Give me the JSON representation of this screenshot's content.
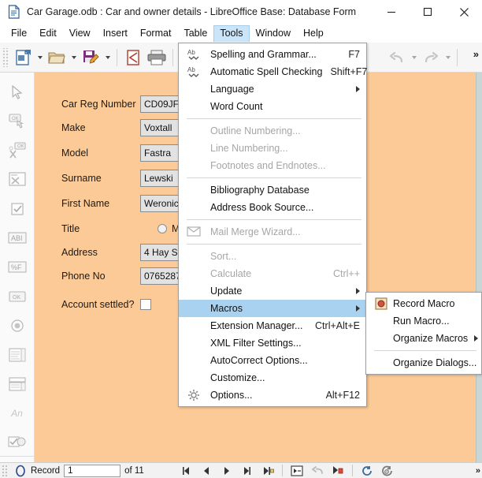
{
  "window": {
    "title": "Car Garage.odb : Car and owner details - LibreOffice Base: Database Form",
    "doc_icon": "document-icon",
    "minimize_label": "Minimize",
    "maximize_label": "Maximize",
    "close_label": "Close"
  },
  "menubar": {
    "items": [
      {
        "label": "File",
        "mnemonic": "F",
        "active": false
      },
      {
        "label": "Edit",
        "mnemonic": "E",
        "active": false
      },
      {
        "label": "View",
        "mnemonic": "V",
        "active": false
      },
      {
        "label": "Insert",
        "mnemonic": "I",
        "active": false
      },
      {
        "label": "Format",
        "mnemonic": "o",
        "active": false
      },
      {
        "label": "Table",
        "mnemonic": "T",
        "active": false
      },
      {
        "label": "Tools",
        "mnemonic": "T",
        "active": true
      },
      {
        "label": "Window",
        "mnemonic": "W",
        "active": false
      },
      {
        "label": "Help",
        "mnemonic": "H",
        "active": false
      }
    ]
  },
  "toolbar": {
    "items": [
      {
        "name": "new-document-button",
        "icon": "new-document-icon",
        "caret": true,
        "disabled": false
      },
      {
        "name": "open-button",
        "icon": "open-folder-icon",
        "caret": true,
        "disabled": false
      },
      {
        "name": "save-button",
        "icon": "save-edit-icon",
        "caret": true,
        "disabled": false
      },
      {
        "name": "export-pdf-button",
        "icon": "pdf-icon",
        "caret": false,
        "disabled": false
      },
      {
        "name": "print-button",
        "icon": "printer-icon",
        "caret": false,
        "disabled": false
      },
      {
        "name": "undo-button",
        "icon": "undo-icon",
        "caret": true,
        "disabled": true
      },
      {
        "name": "redo-button",
        "icon": "redo-icon",
        "caret": true,
        "disabled": true
      }
    ],
    "overflow_label": "»"
  },
  "sidebar": {
    "items": [
      {
        "name": "select-tool",
        "icon": "cursor-arrow-icon"
      },
      {
        "name": "push-button-control",
        "icon": "push-button-icon"
      },
      {
        "name": "form-design-tools",
        "icon": "form-design-icon"
      },
      {
        "name": "control-wizards",
        "icon": "control-wizard-icon"
      },
      {
        "name": "check-box-control",
        "icon": "check-box-icon"
      },
      {
        "name": "label-field-control",
        "icon": "label-field-icon"
      },
      {
        "name": "formatted-field-control",
        "icon": "formatted-field-icon"
      },
      {
        "name": "ok-button-control",
        "icon": "ok-button-icon"
      },
      {
        "name": "option-button-control",
        "icon": "option-button-icon"
      },
      {
        "name": "list-box-control",
        "icon": "list-box-icon"
      },
      {
        "name": "combo-box-control",
        "icon": "combo-box-icon"
      },
      {
        "name": "text-box-control",
        "icon": "text-box-an-icon",
        "text": "An"
      },
      {
        "name": "group-box-control",
        "icon": "group-box-icon"
      },
      {
        "name": "more-controls",
        "icon": "chevron-double-down-icon"
      }
    ]
  },
  "form": {
    "fields": [
      {
        "label": "Car Reg Number",
        "value": "CD09JFT",
        "type": "text"
      },
      {
        "label": "Make",
        "value": "Voxtall",
        "type": "text"
      },
      {
        "label": "Model",
        "value": "Fastra",
        "type": "text"
      },
      {
        "label": "Surname",
        "value": "Lewski",
        "type": "text"
      },
      {
        "label": "First Name",
        "value": "Weronica",
        "type": "text"
      },
      {
        "label": "Title",
        "value": "Mr",
        "type": "radio",
        "checked": false
      },
      {
        "label": "Address",
        "value": "4 Hay St",
        "type": "text"
      },
      {
        "label": "Phone No",
        "value": "076528765",
        "type": "text"
      },
      {
        "label": "Account settled?",
        "value": "",
        "type": "checkbox",
        "checked": false
      }
    ]
  },
  "tools_menu": {
    "items": [
      {
        "label": "Spelling and Grammar...",
        "shortcut": "F7",
        "icon": "abc-check-icon",
        "disabled": false,
        "submenu": false,
        "highlight": false,
        "mnemonic": "S"
      },
      {
        "label": "Automatic Spell Checking",
        "shortcut": "Shift+F7",
        "icon": "abc-auto-icon",
        "disabled": false,
        "submenu": false,
        "highlight": false,
        "mnemonic": "A"
      },
      {
        "label": "Language",
        "shortcut": "",
        "icon": "",
        "disabled": false,
        "submenu": true,
        "highlight": false,
        "mnemonic": "g"
      },
      {
        "label": "Word Count",
        "shortcut": "",
        "icon": "",
        "disabled": false,
        "submenu": false,
        "highlight": false,
        "mnemonic": "W"
      },
      {
        "separator": true
      },
      {
        "label": "Outline Numbering...",
        "shortcut": "",
        "icon": "",
        "disabled": true,
        "submenu": false,
        "highlight": false,
        "mnemonic": "N"
      },
      {
        "label": "Line Numbering...",
        "shortcut": "",
        "icon": "",
        "disabled": true,
        "submenu": false,
        "highlight": false,
        "mnemonic": ""
      },
      {
        "label": "Footnotes and Endnotes...",
        "shortcut": "",
        "icon": "",
        "disabled": true,
        "submenu": false,
        "highlight": false,
        "mnemonic": "F"
      },
      {
        "separator": true
      },
      {
        "label": "Bibliography Database",
        "shortcut": "",
        "icon": "",
        "disabled": false,
        "submenu": false,
        "highlight": false,
        "mnemonic": "B"
      },
      {
        "label": "Address Book Source...",
        "shortcut": "",
        "icon": "",
        "disabled": false,
        "submenu": false,
        "highlight": false,
        "mnemonic": "A"
      },
      {
        "separator": true
      },
      {
        "label": "Mail Merge Wizard...",
        "shortcut": "",
        "icon": "envelope-icon",
        "disabled": true,
        "submenu": false,
        "highlight": false,
        "mnemonic": "z"
      },
      {
        "separator": true
      },
      {
        "label": "Sort...",
        "shortcut": "",
        "icon": "",
        "disabled": true,
        "submenu": false,
        "highlight": false,
        "mnemonic": "r"
      },
      {
        "label": "Calculate",
        "shortcut": "Ctrl++",
        "icon": "",
        "disabled": true,
        "submenu": false,
        "highlight": false,
        "mnemonic": ""
      },
      {
        "label": "Update",
        "shortcut": "",
        "icon": "",
        "disabled": false,
        "submenu": true,
        "highlight": false,
        "mnemonic": "U"
      },
      {
        "label": "Macros",
        "shortcut": "",
        "icon": "",
        "disabled": false,
        "submenu": true,
        "highlight": true,
        "mnemonic": "M"
      },
      {
        "label": "Extension Manager...",
        "shortcut": "Ctrl+Alt+E",
        "icon": "",
        "disabled": false,
        "submenu": false,
        "highlight": false,
        "mnemonic": "E"
      },
      {
        "label": "XML Filter Settings...",
        "shortcut": "",
        "icon": "",
        "disabled": false,
        "submenu": false,
        "highlight": false,
        "mnemonic": "X"
      },
      {
        "label": "AutoCorrect Options...",
        "shortcut": "",
        "icon": "",
        "disabled": false,
        "submenu": false,
        "highlight": false,
        "mnemonic": "A"
      },
      {
        "label": "Customize...",
        "shortcut": "",
        "icon": "",
        "disabled": false,
        "submenu": false,
        "highlight": false,
        "mnemonic": "C"
      },
      {
        "label": "Options...",
        "shortcut": "Alt+F12",
        "icon": "gear-icon",
        "disabled": false,
        "submenu": false,
        "highlight": false,
        "mnemonic": "O"
      }
    ]
  },
  "macros_submenu": {
    "items": [
      {
        "label": "Record Macro",
        "icon": "record-macro-icon",
        "submenu": false,
        "mnemonic": "R"
      },
      {
        "label": "Run Macro...",
        "icon": "",
        "submenu": false,
        "mnemonic": "u"
      },
      {
        "label": "Organize Macros",
        "icon": "",
        "submenu": true,
        "mnemonic": "O"
      },
      {
        "separator": true
      },
      {
        "label": "Organize Dialogs...",
        "icon": "",
        "submenu": false,
        "mnemonic": "D"
      }
    ]
  },
  "navbar": {
    "record_label": "Record",
    "record_value": "1",
    "of_label": "of 11",
    "buttons": [
      {
        "name": "first-record-button",
        "icon": "first-record-icon"
      },
      {
        "name": "previous-record-button",
        "icon": "previous-record-icon"
      },
      {
        "name": "next-record-button",
        "icon": "next-record-icon"
      },
      {
        "name": "last-record-button",
        "icon": "last-record-icon"
      },
      {
        "name": "new-record-button",
        "icon": "new-record-icon"
      },
      {
        "name": "save-record-button",
        "icon": "save-record-icon"
      },
      {
        "name": "undo-entry-button",
        "icon": "undo-entry-icon"
      },
      {
        "name": "delete-record-button",
        "icon": "delete-record-icon"
      },
      {
        "name": "refresh-button",
        "icon": "refresh-icon"
      },
      {
        "name": "refresh-controls-button",
        "icon": "refresh-controls-icon"
      }
    ],
    "overflow_label": "»"
  },
  "colors": {
    "form_background": "#fcca96",
    "menu_highlight": "#a8d2f0",
    "menubar_active": "#cce4f7",
    "input_background": "#e2e2e2",
    "toolbar_background": "#f6f6f6"
  }
}
